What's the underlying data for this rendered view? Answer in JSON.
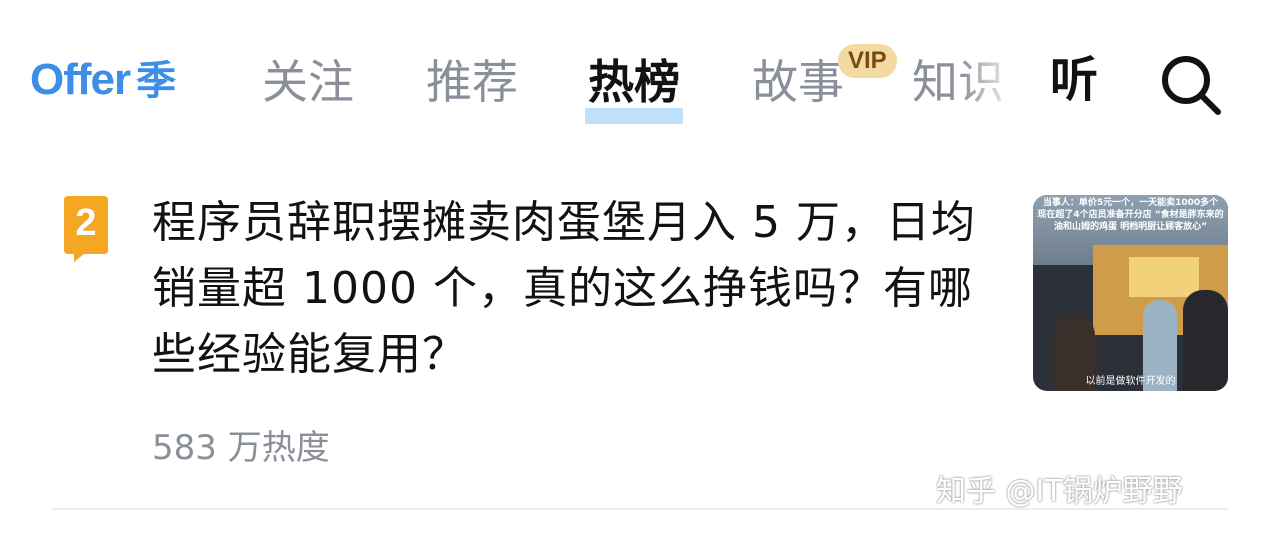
{
  "header": {
    "logo_latin": "Offer",
    "logo_cjk": "季",
    "tabs": [
      {
        "label": "关注",
        "active": false
      },
      {
        "label": "推荐",
        "active": false
      },
      {
        "label": "热榜",
        "active": true
      },
      {
        "label": "故事",
        "active": false,
        "badge": "VIP"
      },
      {
        "label": "知识",
        "active": false
      }
    ],
    "listen_label": "听",
    "search_icon": "search-icon"
  },
  "hot_item": {
    "rank": "2",
    "title": "程序员辞职摆摊卖肉蛋堡月入 5 万，日均销量超 1000 个，真的这么挣钱吗？有哪些经验能复用？",
    "heat": "583 万热度",
    "thumbnail": {
      "overlay_text": "当事人：单价5元一个，一天能卖1000多个 现在超了4个店员准备开分店 “食材是胖东来的油和山姆的鸡蛋 明档明厨让顾客放心”",
      "caption": "以前是做软件开发的"
    }
  },
  "watermark": "知乎 @IT锅炉野野",
  "colors": {
    "brand": "#3d8ee6",
    "rank_badge": "#f5a623",
    "active_underline": "#bfe0fb",
    "vip_badge": "#f3d9a2",
    "muted_text": "#8a8f99"
  }
}
